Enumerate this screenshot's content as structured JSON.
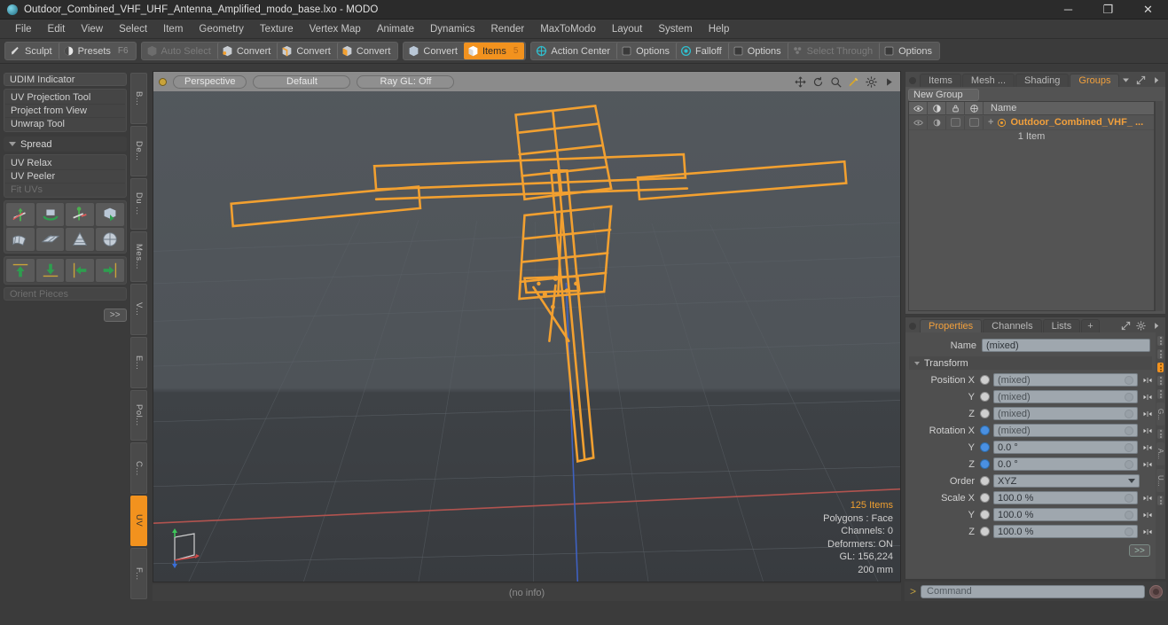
{
  "window": {
    "title": "Outdoor_Combined_VHF_UHF_Antenna_Amplified_modo_base.lxo - MODO",
    "minimize": "─",
    "maximize": "❐",
    "close": "✕"
  },
  "menubar": {
    "items": [
      {
        "label": "File"
      },
      {
        "label": "Edit"
      },
      {
        "label": "View"
      },
      {
        "label": "Select"
      },
      {
        "label": "Item"
      },
      {
        "label": "Geometry"
      },
      {
        "label": "Texture"
      },
      {
        "label": "Vertex Map"
      },
      {
        "label": "Animate"
      },
      {
        "label": "Dynamics"
      },
      {
        "label": "Render"
      },
      {
        "label": "MaxToModo"
      },
      {
        "label": "Layout"
      },
      {
        "label": "System"
      },
      {
        "label": "Help"
      }
    ]
  },
  "toolbar": {
    "sculpt": "Sculpt",
    "presets": "Presets",
    "presets_key": "F6",
    "auto_select": "Auto Select",
    "convert_1": "Convert",
    "convert_2": "Convert",
    "convert_3": "Convert",
    "convert_4": "Convert",
    "items": "Items",
    "items_key": "5",
    "action_center": "Action Center",
    "options_1": "Options",
    "falloff": "Falloff",
    "options_2": "Options",
    "select_through": "Select Through",
    "options_3": "Options"
  },
  "left_panel": {
    "udim_indicator": "UDIM Indicator",
    "uv_projection_tool": "UV Projection Tool",
    "project_from_view": "Project from View",
    "unwrap_tool": "Unwrap Tool",
    "spread": "Spread",
    "uv_relax": "UV Relax",
    "uv_peeler": "UV Peeler",
    "fit_uvs": "Fit UVs",
    "orient_pieces": "Orient Pieces",
    "advanced": ">>",
    "vtabs": [
      {
        "label": "B..."
      },
      {
        "label": "De..."
      },
      {
        "label": "Du ..."
      },
      {
        "label": "Mes..."
      },
      {
        "label": "V..."
      },
      {
        "label": "E..."
      },
      {
        "label": "Pol..."
      },
      {
        "label": "C..."
      },
      {
        "label": "UV",
        "active": true
      },
      {
        "label": "F..."
      }
    ]
  },
  "viewport": {
    "view_mode": "Perspective",
    "shading": "Default",
    "ray_gl": "Ray GL: Off",
    "icons": [
      "move-icon",
      "rotate-icon",
      "zoom-icon",
      "paint-icon",
      "gear-icon",
      "play-icon"
    ],
    "stats": {
      "items": "125 Items",
      "polygons": "Polygons : Face",
      "channels": "Channels: 0",
      "deformers": "Deformers: ON",
      "gl": "GL: 156,224",
      "scale": "200 mm"
    },
    "model_color": "#f2a030",
    "background": "#4d5257",
    "axis_x_color": "#c0504d",
    "axis_z_color": "#3a5fbf"
  },
  "status": {
    "text": "(no info)"
  },
  "groups_pane": {
    "tabs": [
      {
        "label": "Items"
      },
      {
        "label": "Mesh ..."
      },
      {
        "label": "Shading"
      },
      {
        "label": "Groups",
        "active": true
      }
    ],
    "new_group": "New Group",
    "column_name": "Name",
    "column_icons": [
      "eye-icon",
      "render-icon",
      "lock-icon",
      "wireframe-icon"
    ],
    "item_name": "Outdoor_Combined_VHF_ ...",
    "item_count": "1 Item"
  },
  "properties_pane": {
    "tabs": [
      {
        "label": "Properties",
        "active": true
      },
      {
        "label": "Channels"
      },
      {
        "label": "Lists"
      },
      {
        "label": "+"
      }
    ],
    "name_label": "Name",
    "name_value": "(mixed)",
    "transform_header": "Transform",
    "rows": [
      {
        "label": "Position X",
        "value": "(mixed)",
        "blue": false
      },
      {
        "label": "Y",
        "value": "(mixed)",
        "blue": false
      },
      {
        "label": "Z",
        "value": "(mixed)",
        "blue": false
      },
      {
        "label": "Rotation X",
        "value": "(mixed)",
        "blue": true
      },
      {
        "label": "Y",
        "value": "0.0 °",
        "blue": true
      },
      {
        "label": "Z",
        "value": "0.0 °",
        "blue": true
      }
    ],
    "order_label": "Order",
    "order_value": "XYZ",
    "scale_rows": [
      {
        "label": "Scale X",
        "value": "100.0 %"
      },
      {
        "label": "Y",
        "value": "100.0 %"
      },
      {
        "label": "Z",
        "value": "100.0 %"
      }
    ],
    "advanced": ">>",
    "rail_tabs": [
      {
        "label": "G..."
      },
      {
        "label": "A..."
      },
      {
        "label": "U..."
      }
    ]
  },
  "command_bar": {
    "caret": ">",
    "placeholder": "Command",
    "record": "record-icon"
  }
}
